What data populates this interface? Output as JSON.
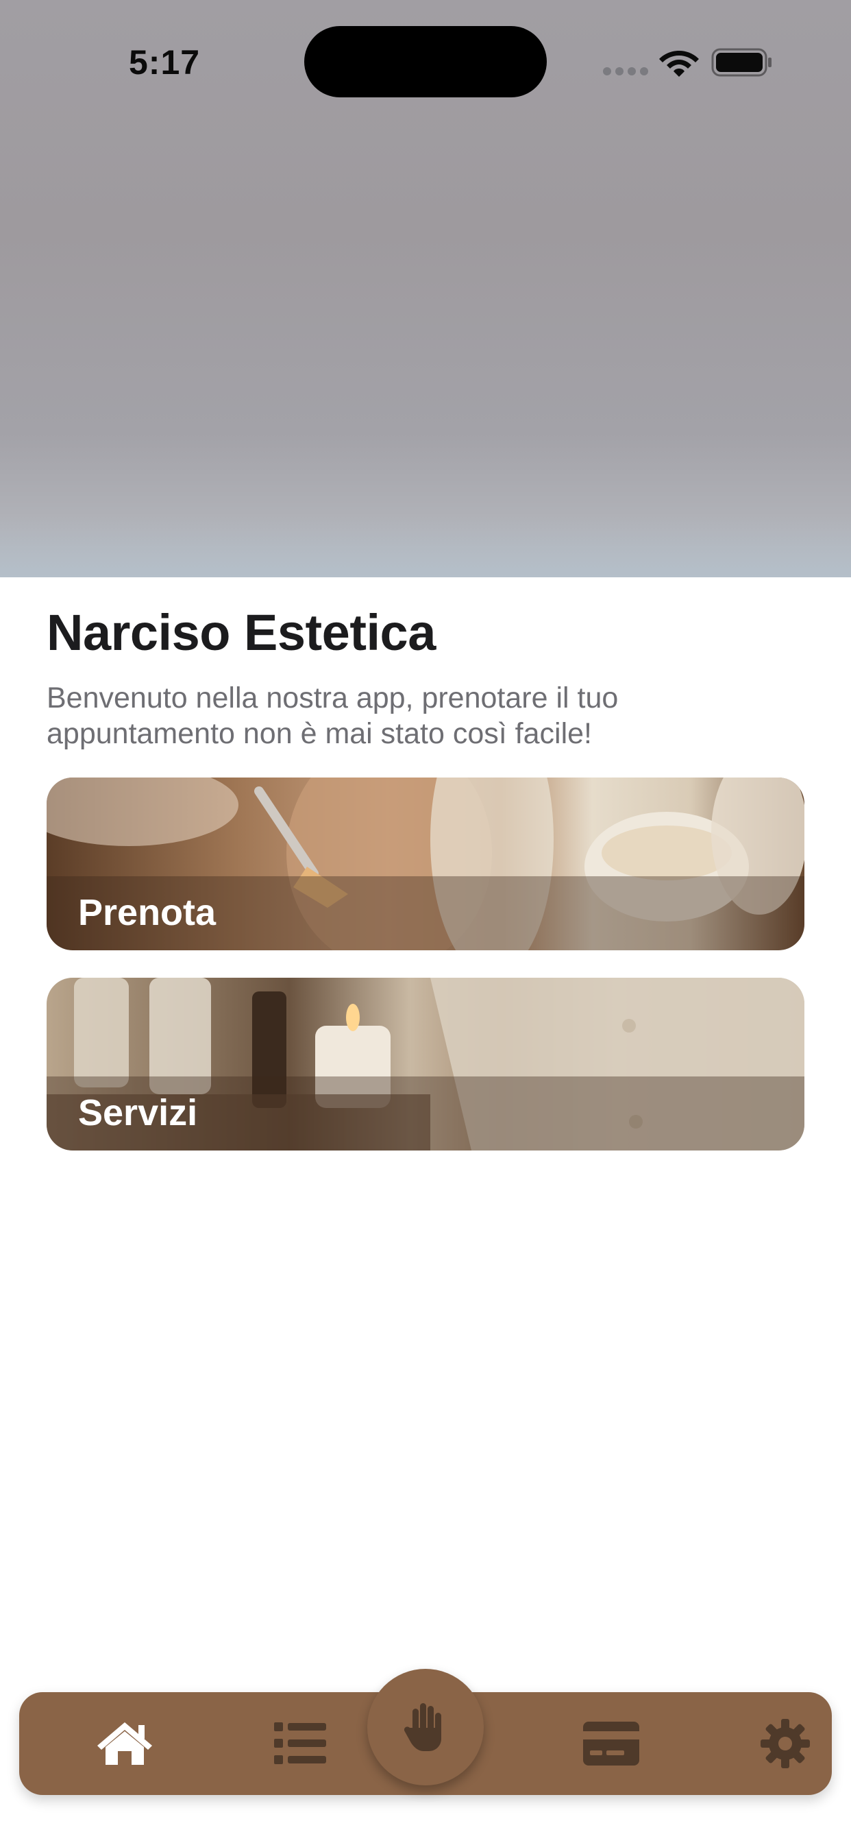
{
  "status_bar": {
    "time": "5:17"
  },
  "header": {
    "title": "Narciso Estetica",
    "welcome_text": "Benvenuto nella nostra app, prenotare il tuo appuntamento non è mai stato così facile!"
  },
  "cards": [
    {
      "label": "Prenota"
    },
    {
      "label": "Servizi"
    }
  ],
  "tab_bar": {
    "items": [
      {
        "icon": "home-icon",
        "active": true
      },
      {
        "icon": "list-icon",
        "active": false
      },
      {
        "icon": "hand-icon",
        "active": false
      },
      {
        "icon": "credit-card-icon",
        "active": false
      },
      {
        "icon": "gear-icon",
        "active": false
      }
    ]
  },
  "colors": {
    "tab_bar_background": "#8a6447",
    "tab_icon_active": "#ffffff",
    "tab_icon_inactive": "#4f3a2a",
    "title_text": "#1c1c1e",
    "subtitle_text": "#6e6e73"
  }
}
